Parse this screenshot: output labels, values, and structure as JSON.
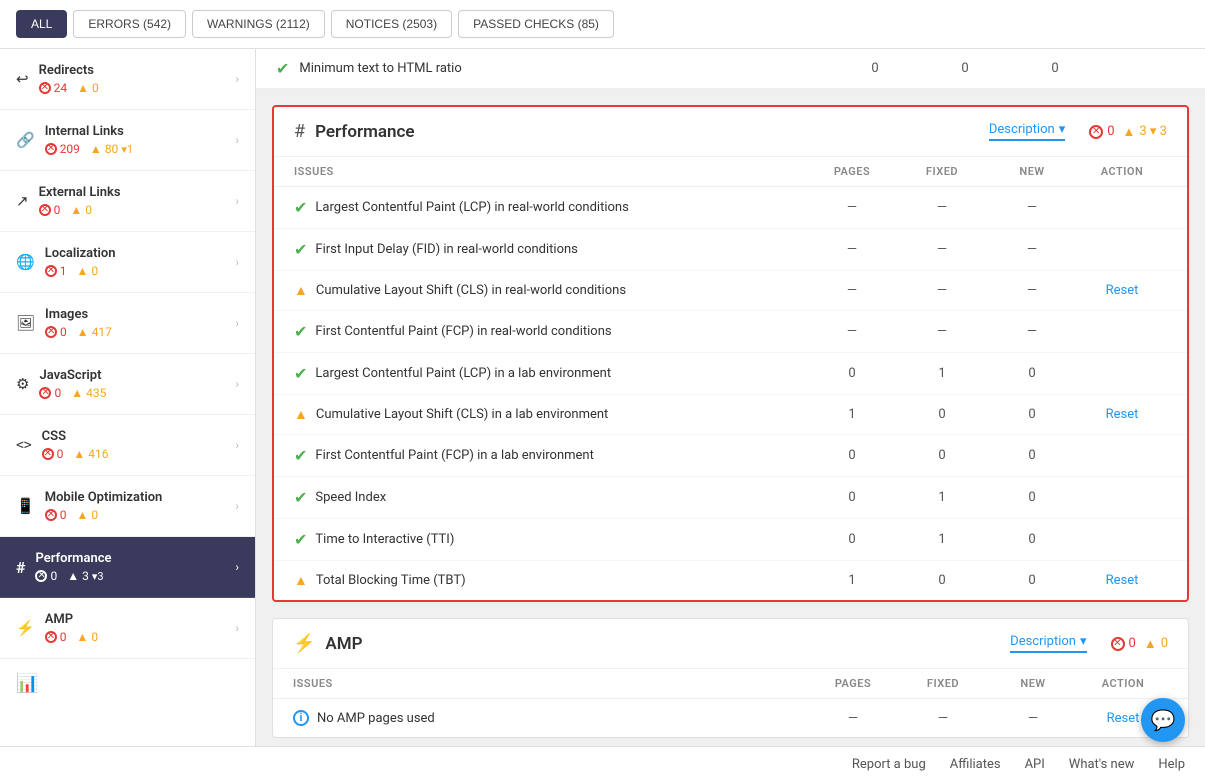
{
  "filterBar": {
    "buttons": [
      {
        "label": "ALL",
        "active": true
      },
      {
        "label": "ERRORS (542)",
        "active": false
      },
      {
        "label": "WARNINGS (2112)",
        "active": false
      },
      {
        "label": "NOTICES (2503)",
        "active": false
      },
      {
        "label": "PASSED CHECKS (85)",
        "active": false
      }
    ]
  },
  "sidebar": {
    "items": [
      {
        "id": "redirects",
        "icon": "↩",
        "label": "Redirects",
        "errors": 24,
        "warnings": 0,
        "active": false
      },
      {
        "id": "internal-links",
        "icon": "🔗",
        "label": "Internal Links",
        "errors": 209,
        "warnings": 80,
        "warningExtra": "▾1",
        "active": false
      },
      {
        "id": "external-links",
        "icon": "↗",
        "label": "External Links",
        "errors": 0,
        "warnings": 0,
        "active": false
      },
      {
        "id": "localization",
        "icon": "🌐",
        "label": "Localization",
        "errors": 1,
        "warnings": 0,
        "active": false
      },
      {
        "id": "images",
        "icon": "🖼",
        "label": "Images",
        "errors": 0,
        "warnings": 417,
        "active": false
      },
      {
        "id": "javascript",
        "icon": "⚙",
        "label": "JavaScript",
        "errors": 0,
        "warnings": 435,
        "active": false
      },
      {
        "id": "css",
        "icon": "<>",
        "label": "CSS",
        "errors": 0,
        "warnings": 416,
        "active": false
      },
      {
        "id": "mobile",
        "icon": "📱",
        "label": "Mobile Optimization",
        "errors": 0,
        "warnings": 0,
        "active": false
      },
      {
        "id": "performance",
        "icon": "#",
        "label": "Performance",
        "errors": 0,
        "warnings": 3,
        "warningExtra": "▾3",
        "active": true
      },
      {
        "id": "amp",
        "icon": "⚡",
        "label": "AMP",
        "errors": 0,
        "warnings": 0,
        "active": false
      }
    ]
  },
  "topSection": {
    "label": "Minimum text to HTML ratio",
    "pages": "0",
    "fixed": "0",
    "new": "0"
  },
  "performance": {
    "title": "Performance",
    "descriptionLabel": "Description",
    "errorsCount": "0",
    "warningsCount": "3 ▾ 3",
    "columns": [
      "ISSUES",
      "PAGES",
      "FIXED",
      "NEW",
      "ACTION"
    ],
    "rows": [
      {
        "name": "Largest Contentful Paint (LCP) in real-world conditions",
        "status": "check",
        "pages": "—",
        "fixed": "—",
        "new": "—",
        "action": ""
      },
      {
        "name": "First Input Delay (FID) in real-world conditions",
        "status": "check",
        "pages": "—",
        "fixed": "—",
        "new": "—",
        "action": ""
      },
      {
        "name": "Cumulative Layout Shift (CLS) in real-world conditions",
        "status": "warn",
        "pages": "—",
        "fixed": "—",
        "new": "—",
        "action": "Reset"
      },
      {
        "name": "First Contentful Paint (FCP) in real-world conditions",
        "status": "check",
        "pages": "—",
        "fixed": "—",
        "new": "—",
        "action": ""
      },
      {
        "name": "Largest Contentful Paint (LCP) in a lab environment",
        "status": "check",
        "pages": "0",
        "fixed": "1",
        "new": "0",
        "action": ""
      },
      {
        "name": "Cumulative Layout Shift (CLS) in a lab environment",
        "status": "warn",
        "pages": "1",
        "fixed": "0",
        "new": "0",
        "action": "Reset"
      },
      {
        "name": "First Contentful Paint (FCP) in a lab environment",
        "status": "check",
        "pages": "0",
        "fixed": "0",
        "new": "0",
        "action": ""
      },
      {
        "name": "Speed Index",
        "status": "check",
        "pages": "0",
        "fixed": "1",
        "new": "0",
        "action": ""
      },
      {
        "name": "Time to Interactive (TTI)",
        "status": "check",
        "pages": "0",
        "fixed": "1",
        "new": "0",
        "action": ""
      },
      {
        "name": "Total Blocking Time (TBT)",
        "status": "warn",
        "pages": "1",
        "fixed": "0",
        "new": "0",
        "action": "Reset"
      }
    ]
  },
  "amp": {
    "title": "AMP",
    "descriptionLabel": "Description",
    "errorsCount": "0",
    "warningsCount": "0",
    "columns": [
      "ISSUES",
      "PAGES",
      "FIXED",
      "NEW",
      "ACTION"
    ],
    "rows": [
      {
        "name": "No AMP pages used",
        "status": "info",
        "pages": "—",
        "fixed": "—",
        "new": "—",
        "action": "Reset"
      }
    ]
  },
  "bottomBar": {
    "links": [
      "Report a bug",
      "Affiliates",
      "API",
      "What's new",
      "Help"
    ]
  }
}
